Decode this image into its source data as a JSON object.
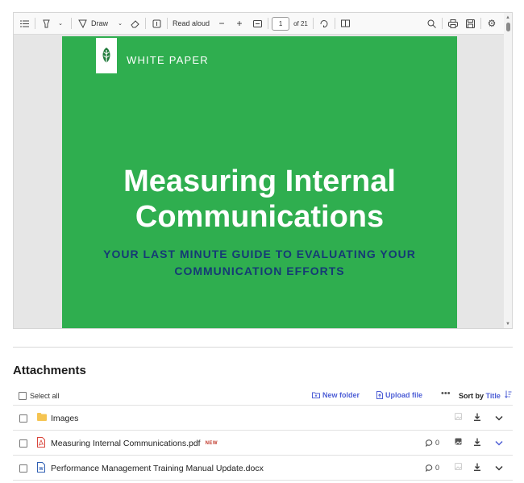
{
  "toolbar": {
    "draw_label": "Draw",
    "read_aloud_label": "Read aloud",
    "page_number": "1",
    "page_total": "of 21"
  },
  "document": {
    "badge": "WHITE PAPER",
    "title_line1": "Measuring Internal",
    "title_line2": "Communications",
    "subtitle_line1": "YOUR LAST MINUTE GUIDE TO EVALUATING YOUR",
    "subtitle_line2": "COMMUNICATION EFFORTS",
    "page_color": "#2fae4f",
    "subtitle_color": "#153a75"
  },
  "attachments": {
    "heading": "Attachments",
    "select_all": "Select all",
    "new_folder": "New folder",
    "upload_file": "Upload file",
    "sort_prefix": "Sort by",
    "sort_field": "Title",
    "accent": "#4e5fd6",
    "items": [
      {
        "name": "Images",
        "icon": "folder-icon",
        "badge": "",
        "comments": ""
      },
      {
        "name": "Measuring Internal Communications.pdf",
        "icon": "pdf-file-icon",
        "badge": "NEW",
        "comments": "0"
      },
      {
        "name": "Performance Management Training Manual Update.docx",
        "icon": "word-file-icon",
        "badge": "",
        "comments": "0"
      }
    ]
  }
}
